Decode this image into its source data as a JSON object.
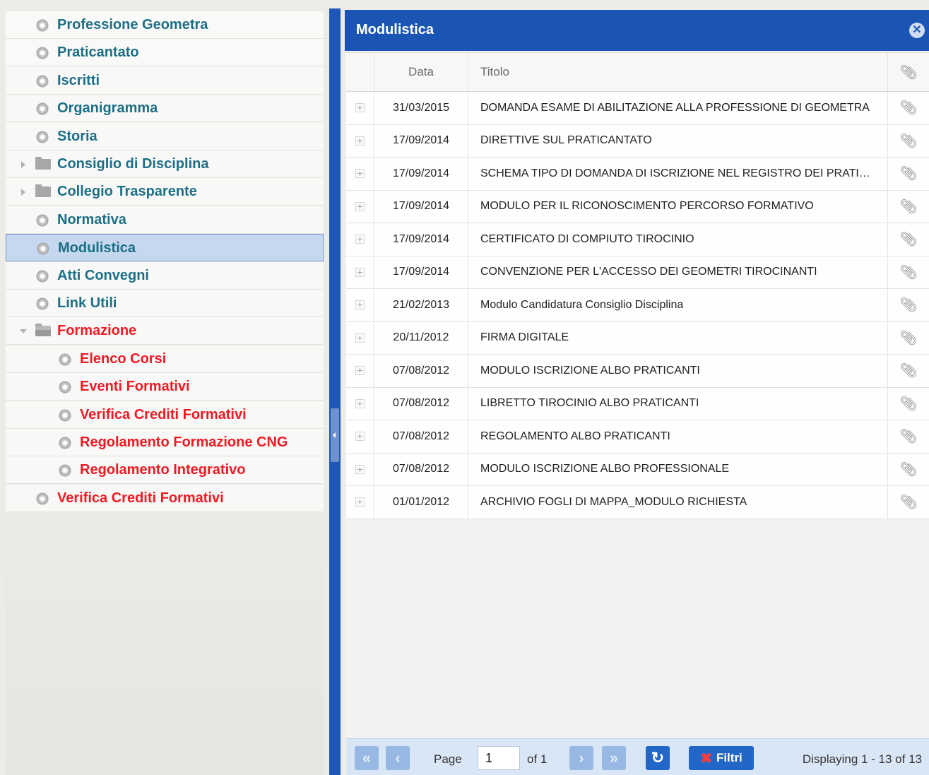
{
  "sidebar": {
    "items": [
      {
        "label": "Professione Geometra",
        "kind": "gear",
        "level": 0,
        "color": "#1d6f86"
      },
      {
        "label": "Praticantato",
        "kind": "gear",
        "level": 0,
        "color": "#1d6f86"
      },
      {
        "label": "Iscritti",
        "kind": "gear",
        "level": 0,
        "color": "#1d6f86"
      },
      {
        "label": "Organigramma",
        "kind": "gear",
        "level": 0,
        "color": "#1d6f86"
      },
      {
        "label": "Storia",
        "kind": "gear",
        "level": 0,
        "color": "#1d6f86"
      },
      {
        "label": "Consiglio di Disciplina",
        "kind": "folder-collapsed",
        "level": 0,
        "color": "#1d6f86"
      },
      {
        "label": "Collegio Trasparente",
        "kind": "folder-collapsed",
        "level": 0,
        "color": "#1d6f86"
      },
      {
        "label": "Normativa",
        "kind": "gear",
        "level": 0,
        "color": "#1d6f86"
      },
      {
        "label": "Modulistica",
        "kind": "gear",
        "level": 0,
        "color": "#1d6f86",
        "selected": true
      },
      {
        "label": "Atti Convegni",
        "kind": "gear",
        "level": 0,
        "color": "#1d6f86"
      },
      {
        "label": "Link Utili",
        "kind": "gear",
        "level": 0,
        "color": "#1d6f86"
      },
      {
        "label": "Formazione",
        "kind": "folder-expanded",
        "level": 0,
        "color": "#ee1b24"
      },
      {
        "label": "Elenco Corsi",
        "kind": "gear",
        "level": 1,
        "color": "#ee1b24"
      },
      {
        "label": "Eventi Formativi",
        "kind": "gear",
        "level": 1,
        "color": "#ee1b24"
      },
      {
        "label": "Verifica Crediti Formativi",
        "kind": "gear",
        "level": 1,
        "color": "#ee1b24"
      },
      {
        "label": "Regolamento Formazione CNG",
        "kind": "gear",
        "level": 1,
        "color": "#ee1b24"
      },
      {
        "label": "Regolamento Integrativo",
        "kind": "gear",
        "level": 1,
        "color": "#ee1b24"
      },
      {
        "label": "Verifica Crediti Formativi",
        "kind": "gear",
        "level": 0,
        "color": "#ee1b24"
      }
    ]
  },
  "panel": {
    "title": "Modulistica",
    "close_icon": "close-circle-icon",
    "columns": {
      "date": "Data",
      "title": "Titolo",
      "attachment_icon": "paperclip-icon"
    },
    "rows": [
      {
        "date": "31/03/2015",
        "title": "DOMANDA ESAME DI ABILITAZIONE ALLA PROFESSIONE DI GEOMETRA"
      },
      {
        "date": "17/09/2014",
        "title": "DIRETTIVE SUL PRATICANTATO"
      },
      {
        "date": "17/09/2014",
        "title": "SCHEMA TIPO DI DOMANDA DI ISCRIZIONE NEL REGISTRO DEI PRATICA..."
      },
      {
        "date": "17/09/2014",
        "title": "MODULO PER IL RICONOSCIMENTO PERCORSO FORMATIVO"
      },
      {
        "date": "17/09/2014",
        "title": "CERTIFICATO DI COMPIUTO TIROCINIO"
      },
      {
        "date": "17/09/2014",
        "title": "CONVENZIONE PER L'ACCESSO DEI GEOMETRI TIROCINANTI"
      },
      {
        "date": "21/02/2013",
        "title": "Modulo Candidatura Consiglio Disciplina"
      },
      {
        "date": "20/11/2012",
        "title": "FIRMA DIGITALE"
      },
      {
        "date": "07/08/2012",
        "title": "MODULO ISCRIZIONE ALBO PRATICANTI"
      },
      {
        "date": "07/08/2012",
        "title": "LIBRETTO TIROCINIO ALBO PRATICANTI"
      },
      {
        "date": "07/08/2012",
        "title": "REGOLAMENTO ALBO PRATICANTI"
      },
      {
        "date": "07/08/2012",
        "title": "MODULO ISCRIZIONE ALBO PROFESSIONALE"
      },
      {
        "date": "01/01/2012",
        "title": "ARCHIVIO FOGLI DI MAPPA_MODULO RICHIESTA"
      }
    ]
  },
  "pager": {
    "page_label": "Page",
    "page_value": "1",
    "of_label": "of 1",
    "filter_label": "Filtri",
    "displaying": "Displaying 1 - 13 of 13",
    "icons": {
      "first": "first-page-icon",
      "prev": "previous-page-icon",
      "next": "next-page-icon",
      "last": "last-page-icon",
      "refresh": "refresh-icon",
      "filter": "filter-clear-icon"
    }
  },
  "colors": {
    "header_blue": "#1b55b4",
    "link_teal": "#1d6f86",
    "link_red": "#ee1b24",
    "selection": "#c6d8ef"
  }
}
